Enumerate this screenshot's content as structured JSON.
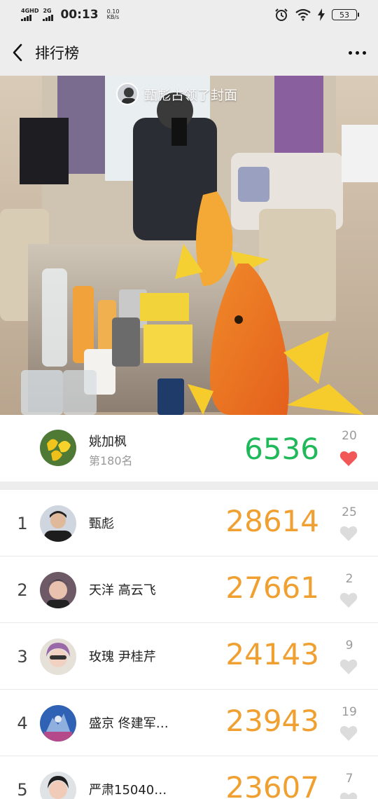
{
  "status_bar": {
    "net1": "4GHD",
    "net2": "2G",
    "time": "00:13",
    "speed_value": "0.10",
    "speed_unit": "KB/s",
    "battery": "53"
  },
  "nav": {
    "title": "排行榜"
  },
  "cover": {
    "caption": "甄彪占领了封面"
  },
  "me": {
    "name": "姚加枫",
    "rank_text": "第180名",
    "steps": "6536",
    "likes": "20"
  },
  "ranking": [
    {
      "rank": "1",
      "name": "甄彪",
      "steps": "28614",
      "likes": "25"
    },
    {
      "rank": "2",
      "name": "天洋 高云飞",
      "steps": "27661",
      "likes": "2"
    },
    {
      "rank": "3",
      "name": "玫瑰 尹桂芹",
      "steps": "24143",
      "likes": "9"
    },
    {
      "rank": "4",
      "name": "盛京 佟建军…",
      "steps": "23943",
      "likes": "19"
    },
    {
      "rank": "5",
      "name": "严肃15040…",
      "steps": "23607",
      "likes": "7"
    }
  ],
  "colors": {
    "steps_orange": "#f0a030",
    "steps_green": "#1fb95a",
    "heart_liked": "#f25757",
    "heart_unliked": "#dcdcdc"
  }
}
